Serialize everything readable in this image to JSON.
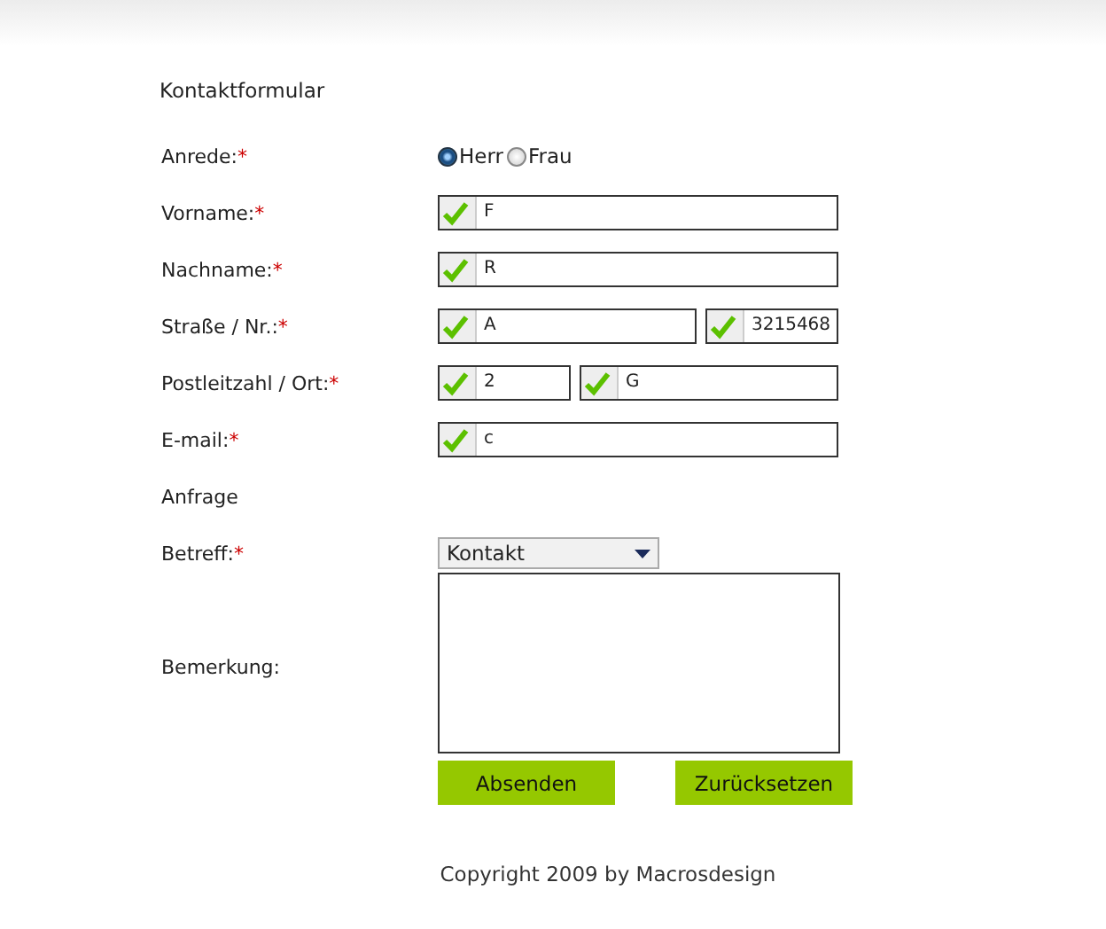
{
  "title": "Kontaktformular",
  "rows": [
    {
      "kind": "radio",
      "label": "Anrede:",
      "mark": "*",
      "options": [
        {
          "label": "Herr",
          "selected": true
        },
        {
          "label": "Frau",
          "selected": false
        }
      ]
    },
    {
      "kind": "fields",
      "label": "Vorname:",
      "mark": "*",
      "fields": [
        {
          "value": "F",
          "valid": true,
          "kind": "full"
        }
      ]
    },
    {
      "kind": "fields",
      "label": "Nachname:",
      "mark": "*",
      "fields": [
        {
          "value": "R",
          "valid": true,
          "kind": "full"
        }
      ]
    },
    {
      "kind": "fields",
      "label": "Straße / Nr.:",
      "mark": "*",
      "fields": [
        {
          "value": "A",
          "valid": true,
          "kind": "long"
        },
        {
          "value": "3215468",
          "valid": true,
          "kind": "short"
        }
      ]
    },
    {
      "kind": "fields",
      "label": "Postleitzahl / Ort:",
      "mark": "*",
      "fields": [
        {
          "value": "2",
          "valid": true,
          "kind": "short"
        },
        {
          "value": "G",
          "valid": true,
          "kind": "long"
        }
      ]
    },
    {
      "kind": "fields",
      "label": "E-mail:",
      "mark": "*",
      "fields": [
        {
          "value": "c",
          "valid": true,
          "kind": "full"
        }
      ]
    },
    {
      "kind": "section",
      "label": "Anfrage"
    },
    {
      "kind": "select",
      "label": "Betreff:",
      "mark": "*",
      "value": "Kontakt"
    },
    {
      "kind": "textarea",
      "label": "Bemerkung:"
    }
  ],
  "buttons": [
    {
      "label": "Absenden"
    },
    {
      "label": "Zurücksetzen"
    }
  ],
  "footer": "Copyright 2009 by Macrosdesign"
}
